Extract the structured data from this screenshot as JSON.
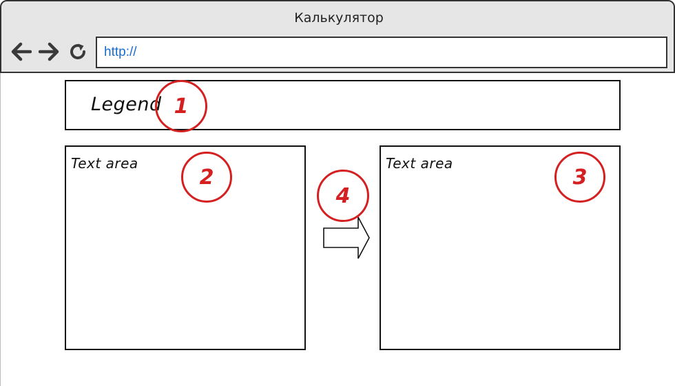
{
  "window": {
    "title": "Калькулятор"
  },
  "toolbar": {
    "back_icon": "arrow-left-icon",
    "forward_icon": "arrow-right-icon",
    "reload_icon": "reload-icon",
    "url_value": "http://"
  },
  "content": {
    "legend": {
      "label": "Legend"
    },
    "text_area_left": {
      "label": "Text area"
    },
    "text_area_right": {
      "label": "Text area"
    },
    "arrow_icon": "right-arrow-icon"
  },
  "annotations": {
    "marker_1": "1",
    "marker_2": "2",
    "marker_3": "3",
    "marker_4": "4"
  },
  "colors": {
    "chrome_bg": "#e6e6e6",
    "url_text": "#1a6bd1",
    "annotation_red": "#d42020",
    "outline": "#111111"
  }
}
